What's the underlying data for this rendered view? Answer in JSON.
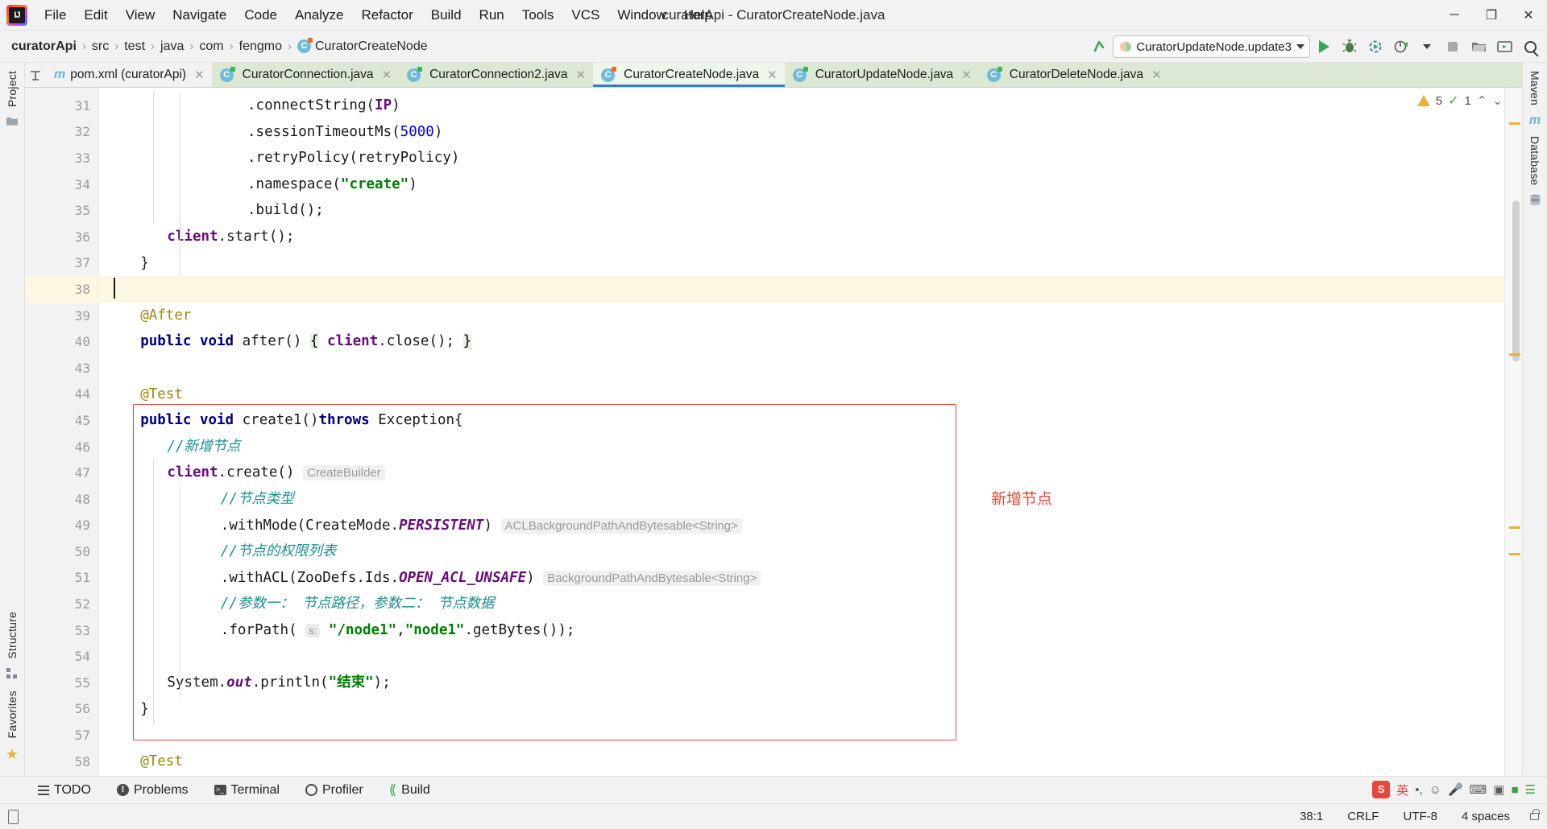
{
  "window": {
    "title": "curatorApi - CuratorCreateNode.java",
    "logo_text": "IJ",
    "minimize": "─",
    "maximize": "❐",
    "close": "✕"
  },
  "menu": {
    "items": [
      {
        "label": "File",
        "mnemonic": "F"
      },
      {
        "label": "Edit",
        "mnemonic": "E"
      },
      {
        "label": "View",
        "mnemonic": "V"
      },
      {
        "label": "Navigate",
        "mnemonic": "N"
      },
      {
        "label": "Code",
        "mnemonic": "C"
      },
      {
        "label": "Analyze",
        "mnemonic": "A"
      },
      {
        "label": "Refactor",
        "mnemonic": "R"
      },
      {
        "label": "Build",
        "mnemonic": "B"
      },
      {
        "label": "Run",
        "mnemonic": "u"
      },
      {
        "label": "Tools",
        "mnemonic": "T"
      },
      {
        "label": "VCS",
        "mnemonic": "V"
      },
      {
        "label": "Window",
        "mnemonic": "W"
      },
      {
        "label": "Help",
        "mnemonic": "H"
      }
    ]
  },
  "breadcrumbs": {
    "items": [
      "curatorApi",
      "src",
      "test",
      "java",
      "com",
      "fengmo"
    ],
    "separator": "›",
    "file": "CuratorCreateNode"
  },
  "toolbar": {
    "update_arrow_icon": "update-project-icon",
    "run_configuration": "CuratorUpdateNode.update3",
    "run_label": "run-button",
    "debug_label": "debug-button",
    "coverage_label": "run-with-coverage-button",
    "profile_label": "profile-button",
    "stop_label": "stop-button",
    "search_label": "search-everywhere-button",
    "accent_green": "#3aa655"
  },
  "sidebars": {
    "left": [
      "Project",
      "Structure",
      "Favorites"
    ],
    "right": [
      "Maven",
      "Database"
    ]
  },
  "tabs": [
    {
      "label": "pom.xml (curatorApi)",
      "icon": "maven-icon",
      "active": false,
      "plain": true
    },
    {
      "label": "CuratorConnection.java",
      "icon": "java-class-icon",
      "active": false
    },
    {
      "label": "CuratorConnection2.java",
      "icon": "java-class-icon",
      "active": false
    },
    {
      "label": "CuratorCreateNode.java",
      "icon": "java-class-icon",
      "active": true
    },
    {
      "label": "CuratorUpdateNode.java",
      "icon": "java-class-icon",
      "active": false
    },
    {
      "label": "CuratorDeleteNode.java",
      "icon": "java-class-icon",
      "active": false
    }
  ],
  "editor": {
    "line_numbers": [
      "31",
      "32",
      "33",
      "34",
      "35",
      "36",
      "37",
      "38",
      "39",
      "40",
      "43",
      "44",
      "45",
      "46",
      "47",
      "48",
      "49",
      "50",
      "51",
      "52",
      "53",
      "54",
      "55",
      "56",
      "57",
      "58"
    ],
    "highlighted_line": "38",
    "annotation_note": "新增节点",
    "lines": [
      {
        "n": "31",
        "indent": 10,
        "html": "<span class=\"plain\">.connectString(</span><span class=\"field\">IP</span><span class=\"plain\">)</span>"
      },
      {
        "n": "32",
        "indent": 10,
        "html": "<span class=\"plain\">.sessionTimeoutMs(</span><span class=\"num\">5000</span><span class=\"plain\">)</span>"
      },
      {
        "n": "33",
        "indent": 10,
        "html": "<span class=\"plain\">.retryPolicy(retryPolicy)</span>"
      },
      {
        "n": "34",
        "indent": 10,
        "html": "<span class=\"plain\">.namespace(</span><span class=\"str\">\"create\"</span><span class=\"plain\">)</span>"
      },
      {
        "n": "35",
        "indent": 10,
        "html": "<span class=\"plain\">.build();</span>"
      },
      {
        "n": "36",
        "indent": 4,
        "html": "<span class=\"field\">client</span><span class=\"plain\">.start();</span>"
      },
      {
        "n": "37",
        "indent": 2,
        "html": "<span class=\"plain\">}</span>"
      },
      {
        "n": "38",
        "indent": 0,
        "html": ""
      },
      {
        "n": "39",
        "indent": 2,
        "html": "<span class=\"anno\">@After</span>"
      },
      {
        "n": "40",
        "indent": 2,
        "html": "<span class=\"kw\">public void</span><span class=\"plain\"> after() </span><span class=\"brmatch\">{</span><span class=\"plain\"> </span><span class=\"field\">client</span><span class=\"plain\">.close(); </span><span class=\"brmatch\">}</span>"
      },
      {
        "n": "43",
        "indent": 0,
        "html": ""
      },
      {
        "n": "44",
        "indent": 2,
        "html": "<span class=\"anno\">@Test</span>"
      },
      {
        "n": "45",
        "indent": 2,
        "html": "<span class=\"kw\">public void</span><span class=\"plain\"> create1()</span><span class=\"kw\">throws</span><span class=\"plain\"> Exception{</span>"
      },
      {
        "n": "46",
        "indent": 4,
        "html": "<span class=\"cmt\">//新增节点</span>"
      },
      {
        "n": "47",
        "indent": 4,
        "html": "<span class=\"field\">client</span><span class=\"plain\">.create()</span> <span class=\"hint\">CreateBuilder</span>"
      },
      {
        "n": "48",
        "indent": 8,
        "html": "<span class=\"cmt\">//节点类型</span>"
      },
      {
        "n": "49",
        "indent": 8,
        "html": "<span class=\"plain\">.withMode(CreateMode.</span><span class=\"statf\">PERSISTENT</span><span class=\"plain\">)</span> <span class=\"hint\">ACLBackgroundPathAndBytesable&lt;String&gt;</span>"
      },
      {
        "n": "50",
        "indent": 8,
        "html": "<span class=\"cmt\">//节点的权限列表</span>"
      },
      {
        "n": "51",
        "indent": 8,
        "html": "<span class=\"plain\">.withACL(ZooDefs.Ids.</span><span class=\"statf\">OPEN_ACL_UNSAFE</span><span class=\"plain\">)</span> <span class=\"hint\">BackgroundPathAndBytesable&lt;String&gt;</span>"
      },
      {
        "n": "52",
        "indent": 8,
        "html": "<span class=\"cmt\">//参数一： 节点路径，参数二： 节点数据</span>"
      },
      {
        "n": "53",
        "indent": 8,
        "html": "<span class=\"plain\">.forPath(</span> <span class=\"phint\">s:</span> <span class=\"str\">\"/node1\"</span><span class=\"plain\">,</span><span class=\"str\">\"node1\"</span><span class=\"plain\">.getBytes());</span>"
      },
      {
        "n": "54",
        "indent": 0,
        "html": ""
      },
      {
        "n": "55",
        "indent": 4,
        "html": "<span class=\"plain\">System.</span><span class=\"statf\">out</span><span class=\"plain\">.println(</span><span class=\"str\">\"结束\"</span><span class=\"plain\">);</span>"
      },
      {
        "n": "56",
        "indent": 2,
        "html": "<span class=\"plain\">}</span>"
      },
      {
        "n": "57",
        "indent": 0,
        "html": ""
      },
      {
        "n": "58",
        "indent": 2,
        "html": "<span class=\"anno\">@Test</span>"
      }
    ]
  },
  "inspection": {
    "warning_count": "5",
    "warning_icon": "warning-triangle-icon",
    "weak_warning_count": "1",
    "weak_warning_icon": "weak-warning-icon",
    "prev_problem": "⌃",
    "next_problem": "⌄"
  },
  "bottom_tools": [
    {
      "label": "TODO",
      "icon": "todo-icon"
    },
    {
      "label": "Problems",
      "icon": "problems-icon"
    },
    {
      "label": "Terminal",
      "icon": "terminal-icon"
    },
    {
      "label": "Profiler",
      "icon": "profiler-icon"
    },
    {
      "label": "Build",
      "icon": "build-hammer-icon"
    }
  ],
  "statusbar": {
    "caret_position": "38:1",
    "line_separator": "CRLF",
    "encoding": "UTF-8",
    "indent": "4 spaces",
    "lock_icon": "read-only-lock-icon",
    "memory_icon": "phone-icon"
  },
  "ime": {
    "brand": "S",
    "mode": "英",
    "icons": [
      "punctuation-icon",
      "emoji-icon",
      "mic-icon",
      "keyboard-icon",
      "screenshot-icon",
      "toolbox-icon",
      "menu-icon"
    ]
  },
  "colors": {
    "tab_bar_bg": "#dde8d4",
    "active_tab_bg": "#eef5ea",
    "active_tab_underline": "#3a7dc9",
    "annotation_red": "#e8453c",
    "highlight_line": "#fdf6e3",
    "accent_green": "#3aa655",
    "string_green": "#008000",
    "keyword_navy": "#000080",
    "comment_teal": "#1a8f8f",
    "annotation_gold": "#9e880d",
    "field_purple": "#660e7a"
  }
}
